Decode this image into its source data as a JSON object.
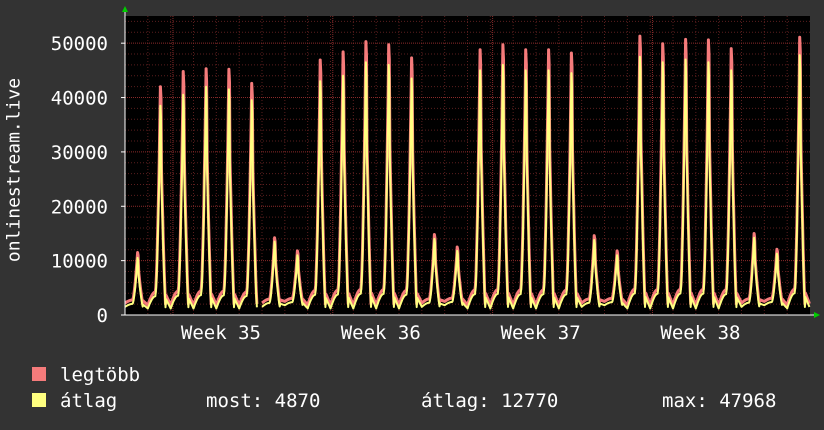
{
  "chart_data": {
    "type": "area",
    "ylabel": "onlinestream.live",
    "ylim": [
      0,
      55000
    ],
    "yticks": [
      0,
      10000,
      20000,
      30000,
      40000,
      50000
    ],
    "xticks": [
      "Week 35",
      "Week 36",
      "Week 37",
      "Week 38"
    ],
    "grid": true,
    "legend_position": "bottom-left",
    "series": [
      {
        "name": "legtöbb",
        "color": "#f57b7b"
      },
      {
        "name": "átlag",
        "color": "#ffff80"
      }
    ],
    "daily_peaks": {
      "max": [
        11500,
        42000,
        44800,
        45300,
        45200,
        42600,
        14200,
        11800,
        46900,
        48400,
        50300,
        49700,
        47300,
        14800,
        12500,
        48800,
        49700,
        48800,
        48800,
        48200,
        14600,
        11800,
        51300,
        49900,
        50700,
        50600,
        49000,
        15000,
        12100,
        51100
      ],
      "avg": [
        10500,
        38500,
        40500,
        42000,
        41500,
        39500,
        13500,
        11000,
        43000,
        44000,
        46500,
        46000,
        43500,
        14000,
        11800,
        45000,
        46000,
        45000,
        45000,
        44500,
        13800,
        11000,
        47500,
        46500,
        47000,
        46500,
        45000,
        14200,
        11300,
        47800
      ]
    },
    "daily_min_max": [
      2200,
      1800,
      1800,
      1800,
      1800,
      1800,
      2200,
      2500,
      1800,
      1800,
      1800,
      1800,
      1800,
      2200,
      2500,
      1800,
      1800,
      1800,
      1800,
      1800,
      2200,
      2500,
      1800,
      1800,
      1800,
      1800,
      1800,
      2200,
      2500,
      1800
    ],
    "daily_min_avg": [
      1500,
      1200,
      1200,
      1200,
      1200,
      1200,
      1500,
      1800,
      1200,
      1200,
      1200,
      1200,
      1200,
      1500,
      1800,
      1200,
      1200,
      1200,
      1200,
      1200,
      1500,
      1800,
      1200,
      1200,
      1200,
      1200,
      1200,
      1500,
      1800,
      1200
    ],
    "gap_after_day": 5,
    "start_value": 10000,
    "end_value": 4870
  },
  "legend": {
    "max_label": "legtöbb",
    "avg_label": "átlag",
    "current_label": "most:",
    "current_value": "4870",
    "average_label": "átlag:",
    "average_value": "12770",
    "maximum_label": "max:",
    "maximum_value": "47968"
  },
  "colors": {
    "background": "#333333",
    "plot_background": "#000000",
    "grid": "#5a1e1e",
    "axis": "#ffffff",
    "arrow": "#00cc00"
  }
}
